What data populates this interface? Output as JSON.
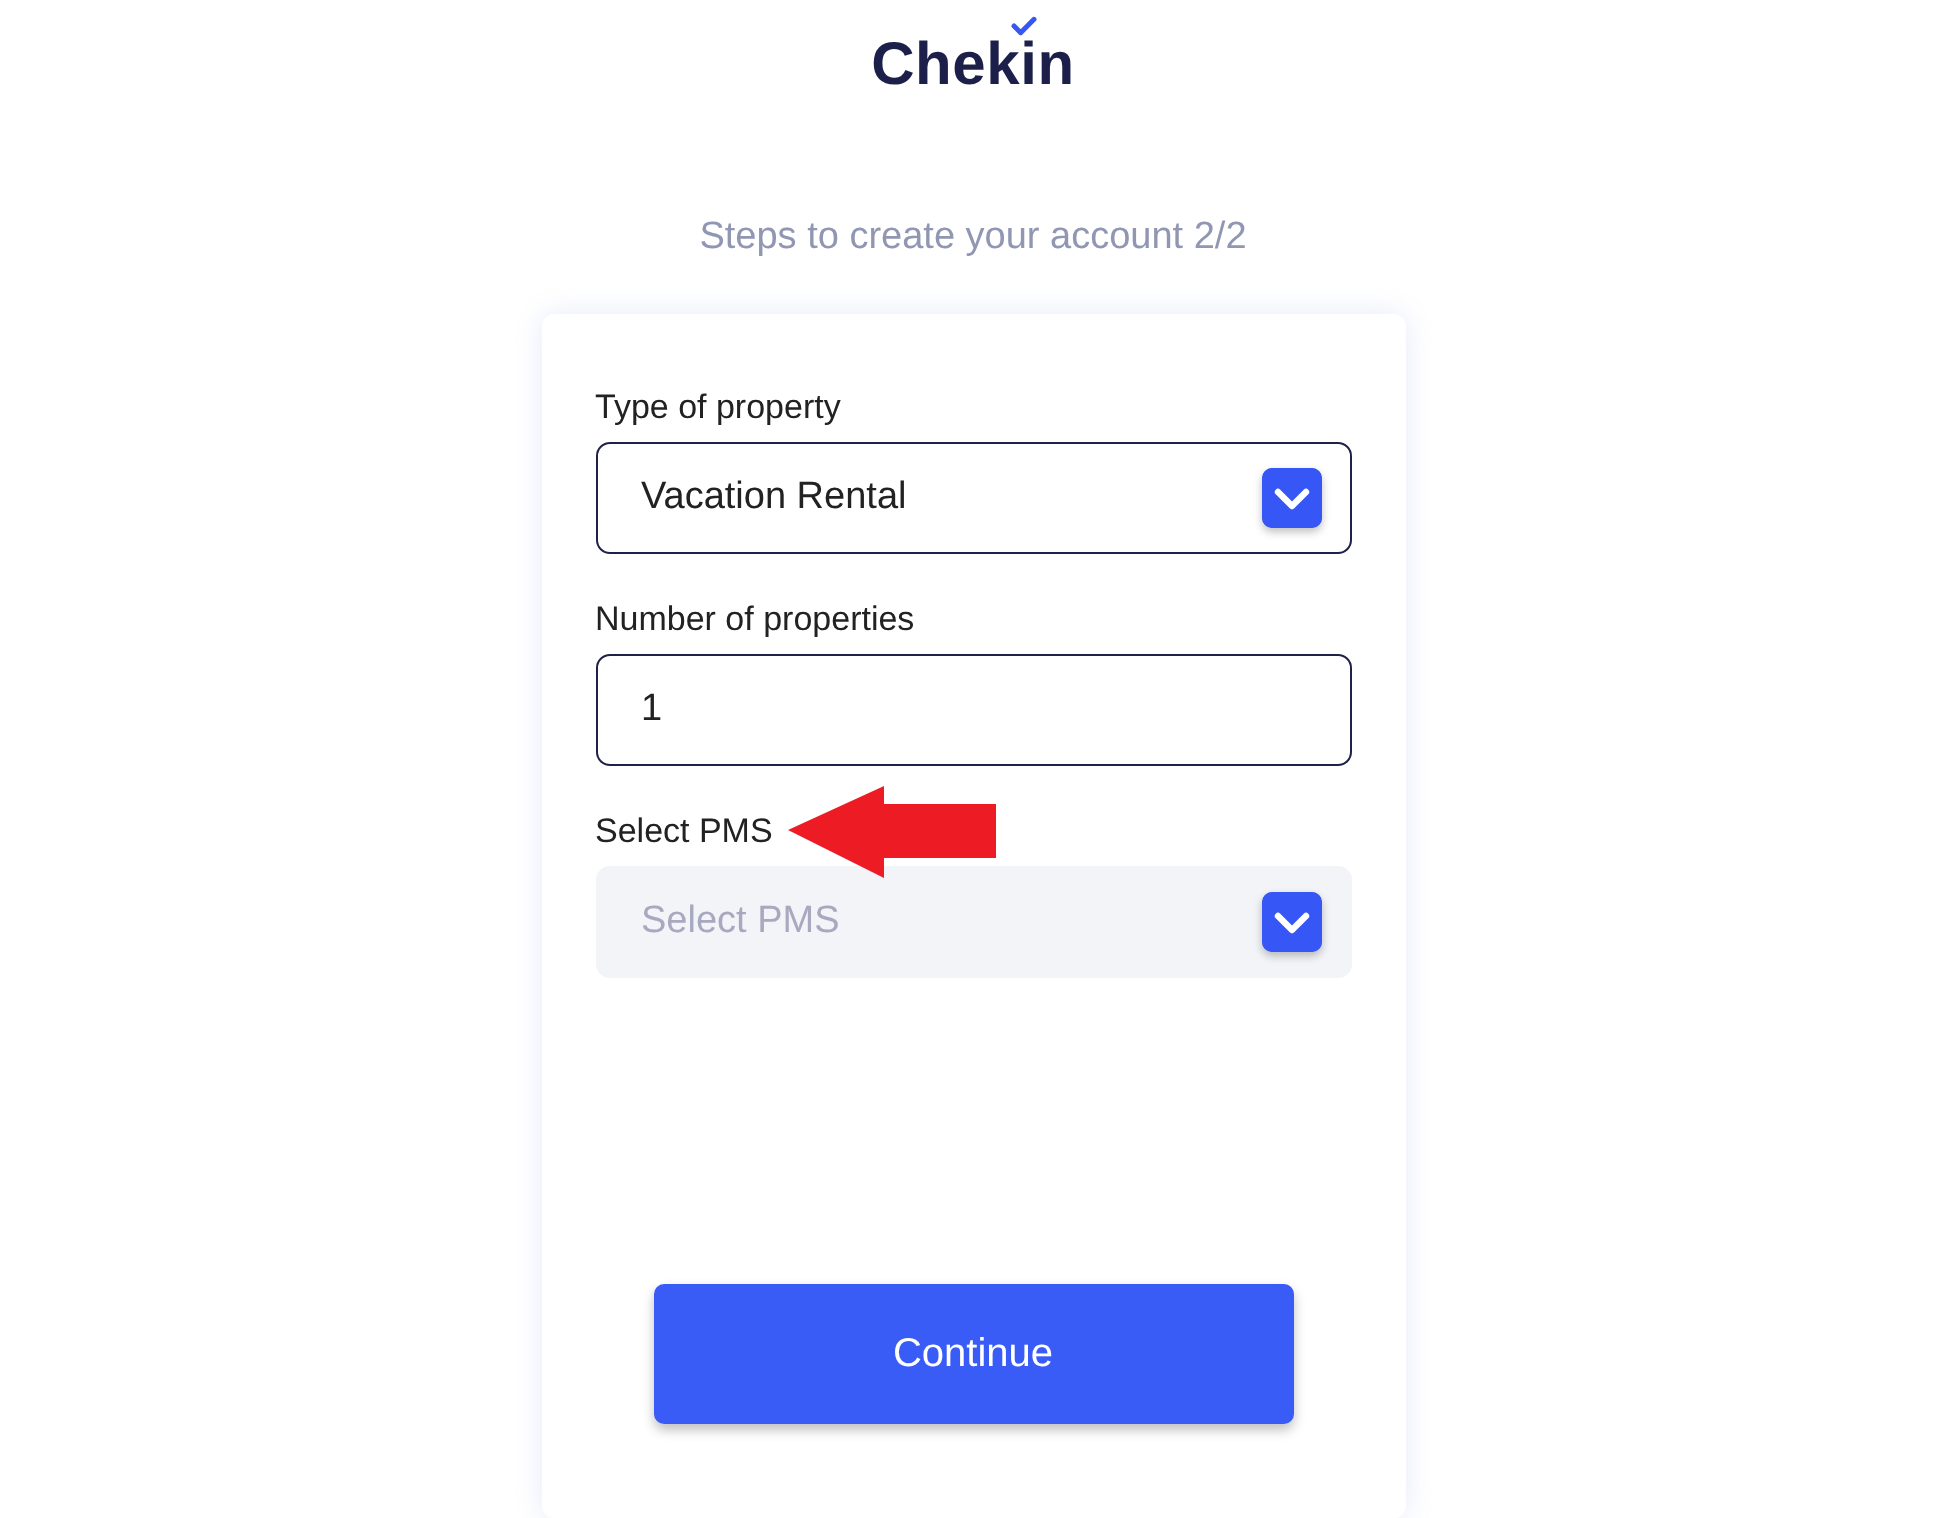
{
  "logo": {
    "text": "Chekin"
  },
  "subtitle": "Steps to create your account 2/2",
  "fields": [
    {
      "kind": "select",
      "label": "Type of property",
      "value": "Vacation Rental",
      "disabled": false,
      "annotated": false
    },
    {
      "kind": "input",
      "label": "Number of properties",
      "value": "1",
      "disabled": false,
      "annotated": false
    },
    {
      "kind": "select",
      "label": "Select PMS",
      "placeholder": "Select PMS",
      "disabled": true,
      "annotated": true
    }
  ],
  "button": {
    "label": "Continue"
  }
}
